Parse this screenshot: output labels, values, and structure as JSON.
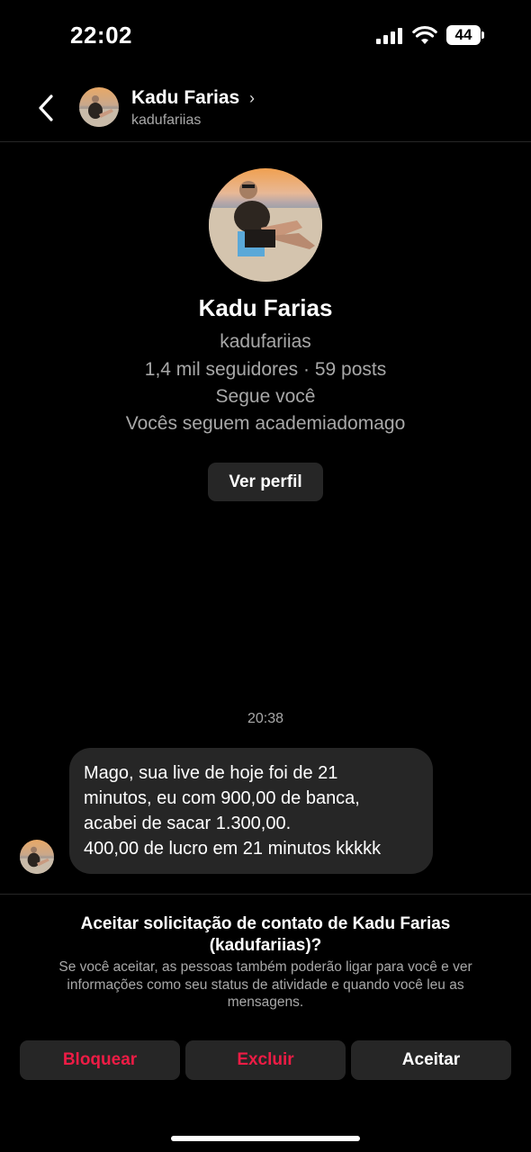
{
  "status_bar": {
    "time": "22:02",
    "battery": "44"
  },
  "header": {
    "name": "Kadu Farias",
    "chevron": "›",
    "username": "kadufariias"
  },
  "profile": {
    "name": "Kadu Farias",
    "username": "kadufariias",
    "stats": "1,4 mil seguidores · 59 posts",
    "follows_you": "Segue você",
    "mutual": "Vocês seguem academiadomago",
    "view_profile_label": "Ver perfil"
  },
  "conversation": {
    "timestamp": "20:38",
    "message_lines": [
      "Mago, sua live de hoje foi de 21",
      "minutos, eu com 900,00 de banca,",
      "acabei de sacar 1.300,00.",
      "400,00 de lucro em 21 minutos kkkkk"
    ]
  },
  "request": {
    "title_line1": "Aceitar solicitação de contato de Kadu Farias",
    "title_line2": "(kadufariias)?",
    "desc_line1": "Se você aceitar, as pessoas também poderão ligar para você e ver",
    "desc_line2": "informações como seu status de atividade e quando você leu as",
    "desc_line3": "mensagens.",
    "block_label": "Bloquear",
    "delete_label": "Excluir",
    "accept_label": "Aceitar"
  },
  "colors": {
    "danger": "#ed1c45",
    "secondary_text": "#a8a8a8",
    "surface": "#262626"
  },
  "icons": {
    "back": "chevron-left-icon",
    "signal": "signal-icon",
    "wifi": "wifi-icon",
    "battery": "battery-icon"
  }
}
